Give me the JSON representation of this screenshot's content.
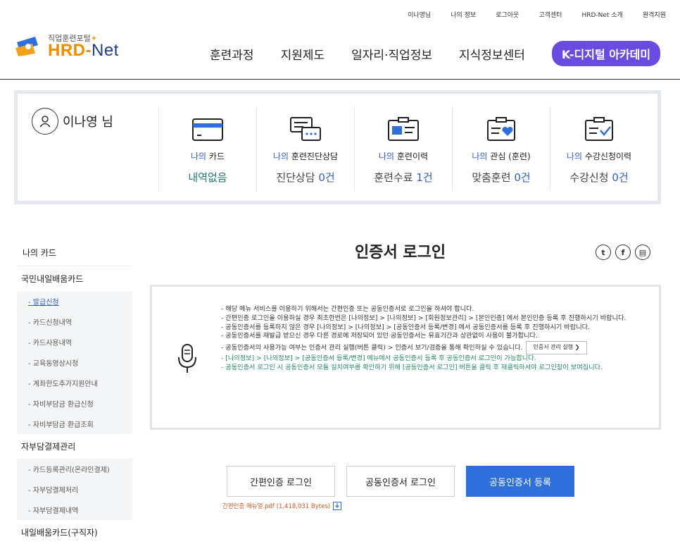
{
  "utility": [
    "이나영님",
    "나의 정보",
    "로그아웃",
    "고객센터",
    "HRD-Net 소개",
    "원격지원"
  ],
  "logo": {
    "small": "직업훈련포털",
    "hrd": "HRD-",
    "net": "Net"
  },
  "gnb": [
    "훈련과정",
    "지원제도",
    "일자리·직업정보",
    "지식정보센터"
  ],
  "gnb_special": "K-디지털 아카데미",
  "user": {
    "name": "이나영 님"
  },
  "cells": [
    {
      "prefix": "나의",
      "label": "카드",
      "value": "내역없음",
      "icon": "card-icon"
    },
    {
      "prefix": "나의",
      "label": "훈련진단상담",
      "value_text": "진단상담",
      "count": "0건",
      "icon": "chat-icon"
    },
    {
      "prefix": "나의",
      "label": "훈련이력",
      "value_text": "훈련수료",
      "count": "1건",
      "icon": "history-icon"
    },
    {
      "prefix": "나의",
      "label": "관심 (훈련)",
      "value_text": "맞춤훈련",
      "count": "0건",
      "icon": "heart-folder-icon"
    },
    {
      "prefix": "나의",
      "label": "수강신청이력",
      "value_text": "수강신청",
      "count": "0건",
      "icon": "check-folder-icon"
    }
  ],
  "sidebar": {
    "head": "나의 카드",
    "groups": [
      {
        "label": "국민내일배움카드",
        "items": [
          "발급신청",
          "카드신청내역",
          "카드사용내역",
          "교육동영상시청",
          "계좌한도추가지원안내",
          "자비부담금 환급신청",
          "자비부담금 환급조회"
        ]
      },
      {
        "label": "자부담결제관리",
        "items": [
          "카드등록관리(온라인결제)",
          "자부담결제처리",
          "자부담결제내역"
        ]
      },
      {
        "label": "내일배움카드(구직자)",
        "items": []
      }
    ],
    "active": "발급신청"
  },
  "content": {
    "title": "인증서 로그인",
    "share": [
      "twitter-icon",
      "facebook-icon",
      "print-icon"
    ],
    "notes": [
      "- 해당 메뉴 서비스를 이용하기 위해서는 간편인증 또는 공동인증서로 로그인을 하셔야 합니다.",
      "- 간편인증 로그인을 이용하실 경우 최초한번은 [나의정보] > [나의정보] > [회원정보관리] > [본인인증] 에서 본인인증 등록 후 진행하시기 바랍니다.",
      "- 공동인증서를 등록하지 않은 경우 [나의정보] > [나의정보] > [공동인증서 등록/변경] 에서 공동인증서를 등록 후 진행하시기 바랍니다.",
      "- 공동인증서를 재발급 받으신 경우 다른 경로에 저장되어 있던 공동인증서는 유효기간과 상관없이 사용이 불가합니다.",
      "- 공동인증서의 사용가능 여부는 인증서 관리 실행(버튼 클릭) > 인증서 보기/검증을 통해 확인하실 수 있습니다."
    ],
    "cert_button": "인증서 관리 실행 ❯",
    "green_notes": [
      "- [나의정보] > [나의정보] > [공동인증서 등록/변경] 메뉴에서 공동인증서 등록 후 공동인증서 로그인이 가능합니다.",
      "- 공동인증서 로그인 시 공동인증서 모듈 설치여부를 확인하기 위해 [공동인증서 로그인] 버튼을 클릭 후 재클릭하셔야 로그인창이 보여집니다."
    ],
    "buttons": [
      "간편인증 로그인",
      "공동인증서 로그인",
      "공동인증서 등록"
    ],
    "manual": "간편인증 매뉴얼.pdf (1,418,031 Bytes)"
  }
}
